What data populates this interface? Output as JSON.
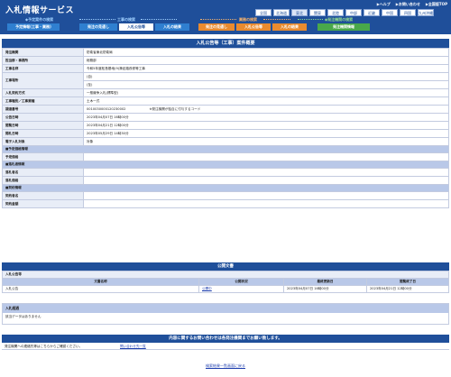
{
  "header": {
    "logo": "入札情報サービス",
    "links": [
      "▶ヘルプ",
      "▶お問い合わせ",
      "▶全国版TOP"
    ],
    "regions": [
      "全国",
      "北海道",
      "東北",
      "関東",
      "北陸",
      "中部",
      "近畿",
      "中国",
      "四国",
      "九州沖縄"
    ],
    "sections": [
      {
        "label": "◆予定案件の検索",
        "tabs": [
          "予定情報(工事・業務)"
        ],
        "color": "#2f7fd0"
      },
      {
        "label": "工事の検索",
        "tabs": [
          "発注の見通し",
          "入札公告等",
          "入札の結果"
        ],
        "color": "#2f7fd0"
      },
      {
        "label": "業務の検索",
        "tabs": [
          "発注の見通し",
          "入札公告等",
          "入札の結果"
        ],
        "color": "#ea8b2f"
      },
      {
        "label": "◆発注機関の検索",
        "tabs": [
          "発注機関情報"
        ],
        "color": "#49a84a"
      }
    ]
  },
  "main": {
    "title": "入札公告等（工事）案件概要",
    "rows": [
      {
        "label": "発注機関",
        "value": "防衛省東北防衛局"
      },
      {
        "label": "担当部・事務所",
        "value": "総務部"
      },
      {
        "label": "工事名称",
        "value": "令和5年度松島基地(9)滑走路改修等工事"
      },
      {
        "label": "工事場所",
        "value": "(自)",
        "value2": "(至)"
      },
      {
        "label": "入札契約方式",
        "value": "一般競争入札(標準型)"
      },
      {
        "label": "工事種別／工事業種",
        "value": "土木一式"
      },
      {
        "label": "調達番号",
        "value": "0010030000120230002",
        "note": "※発注機関が独自に付与するコード"
      },
      {
        "label": "公告日時",
        "value": "2023年04月07日 16時00分"
      },
      {
        "label": "閲覧日時",
        "value": "2023年04月21日 12時00分"
      },
      {
        "label": "開札日時",
        "value": "2023年05月29日 14時30分"
      },
      {
        "label": "電子入札対象",
        "value": "対象"
      }
    ],
    "group_price": "■予定価格情報",
    "price_label": "予定価格",
    "group_winner": "■落札者情報",
    "winner_name_label": "落札者名",
    "winner_price_label": "落札価格",
    "group_contract": "■契約情報",
    "contractor_label": "契約者名",
    "contract_amount_label": "契約金額"
  },
  "docs": {
    "title": "公開文書",
    "sub_title": "入札公告等",
    "columns": [
      "文書名称",
      "公開状況",
      "最終更新日",
      "閲覧終了日"
    ],
    "rows": [
      {
        "name": "入札公告",
        "status": "公開中",
        "updated": "2023年04月07日 16時00分",
        "end": "2023年04月21日 12時00分"
      }
    ]
  },
  "result": {
    "title": "入札経過",
    "body": "該当データはありません"
  },
  "contact": {
    "bar": "内容に関するお問い合わせは各発注機関までお願い致します。",
    "label": "発注機関への連絡先等はこちらからご確認ください。",
    "link": "問い合わせ先一覧"
  },
  "back": "検索結果一覧画面に戻る"
}
